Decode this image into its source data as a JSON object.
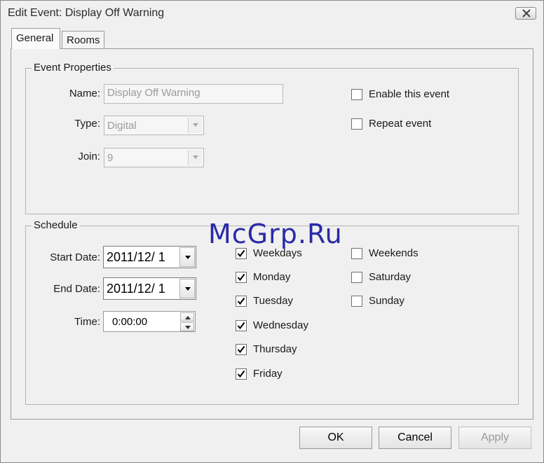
{
  "window": {
    "title": "Edit Event: Display Off Warning"
  },
  "tabs": [
    {
      "label": "General",
      "active": true
    },
    {
      "label": "Rooms",
      "active": false
    }
  ],
  "event_properties": {
    "legend": "Event Properties",
    "name_label": "Name:",
    "name_value": "Display Off Warning",
    "type_label": "Type:",
    "type_value": "Digital",
    "join_label": "Join:",
    "join_value": "9",
    "enable_label": "Enable this event",
    "enable_checked": false,
    "repeat_label": "Repeat event",
    "repeat_checked": false
  },
  "schedule": {
    "legend": "Schedule",
    "start_date_label": "Start Date:",
    "start_date_value": "2011/12/ 1",
    "end_date_label": "End Date:",
    "end_date_value": "2011/12/ 1",
    "time_label": "Time:",
    "time_value": "0:00:00",
    "days_left": [
      {
        "label": "Weekdays",
        "checked": true
      },
      {
        "label": "Monday",
        "checked": true
      },
      {
        "label": "Tuesday",
        "checked": true
      },
      {
        "label": "Wednesday",
        "checked": true
      },
      {
        "label": "Thursday",
        "checked": true
      },
      {
        "label": "Friday",
        "checked": true
      }
    ],
    "days_right": [
      {
        "label": "Weekends",
        "checked": false
      },
      {
        "label": "Saturday",
        "checked": false
      },
      {
        "label": "Sunday",
        "checked": false
      }
    ]
  },
  "buttons": {
    "ok": "OK",
    "cancel": "Cancel",
    "apply": "Apply"
  },
  "watermark": "McGrp.Ru"
}
